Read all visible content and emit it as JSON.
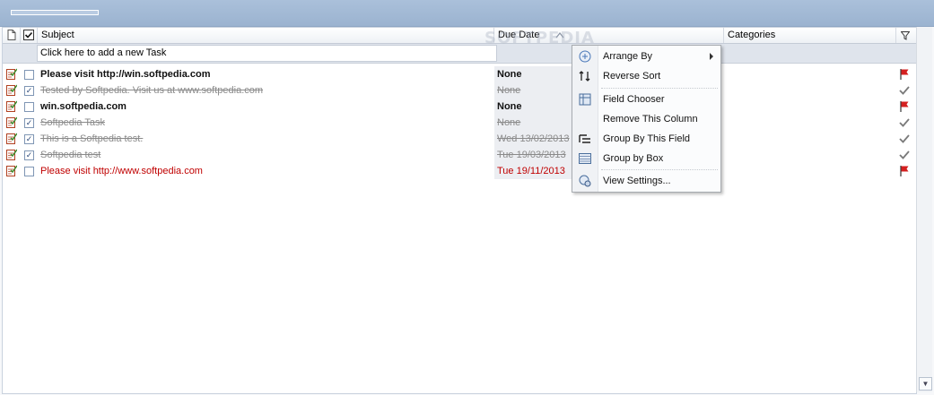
{
  "columns": {
    "subject": "Subject",
    "due_date": "Due Date",
    "categories": "Categories"
  },
  "add_task_placeholder": "Click here to add a new Task",
  "tasks": [
    {
      "subject": "Please visit http://win.softpedia.com",
      "due": "None",
      "done": false,
      "style": "bold"
    },
    {
      "subject": "Tested by Softpedia. Visit us at www.softpedia.com",
      "due": "None",
      "done": true,
      "style": "done"
    },
    {
      "subject": "win.softpedia.com",
      "due": "None",
      "done": false,
      "style": "bold"
    },
    {
      "subject": "Softpedia Task",
      "due": "None",
      "done": true,
      "style": "done"
    },
    {
      "subject": "This is a Softpedia test.",
      "due": "Wed 13/02/2013",
      "done": true,
      "style": "done"
    },
    {
      "subject": "Softpedia test",
      "due": "Tue 19/03/2013",
      "done": true,
      "style": "done"
    },
    {
      "subject": "Please visit http://www.softpedia.com",
      "due": "Tue 19/11/2013",
      "done": false,
      "style": "red"
    }
  ],
  "context_menu": {
    "arrange_by": "Arrange By",
    "reverse_sort": "Reverse Sort",
    "field_chooser": "Field Chooser",
    "remove_column": "Remove This Column",
    "group_by_field": "Group By This Field",
    "group_by_box": "Group by Box",
    "view_settings": "View Settings..."
  },
  "watermark": "SOFTPEDIA",
  "colors": {
    "flag_red": "#d42020",
    "check_gray": "#7a7a7a",
    "overdue_red": "#c00000",
    "header_blue": "#9bb3d0"
  }
}
